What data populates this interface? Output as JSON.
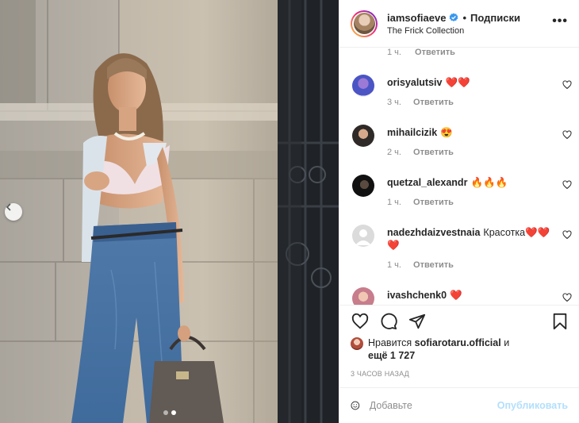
{
  "header": {
    "username": "iamsofiaeve",
    "separator": "•",
    "follow_label": "Подписки",
    "location": "The Frick Collection",
    "more_icon": "more-horizontal-icon"
  },
  "previous_comment_meta": {
    "time": "1 ч.",
    "reply": "Ответить"
  },
  "comments": [
    {
      "user": "orisyalutsiv",
      "text": "❤️❤️",
      "time": "3 ч.",
      "reply": "Ответить"
    },
    {
      "user": "mihailcizik",
      "text": "😍",
      "time": "2 ч.",
      "reply": "Ответить"
    },
    {
      "user": "quetzal_alexandr",
      "text": "🔥🔥🔥",
      "time": "1 ч.",
      "reply": "Ответить"
    },
    {
      "user": "nadezhdaizvestnaia",
      "text": "Красотка❤️❤️❤️",
      "time": "1 ч.",
      "reply": "Ответить"
    },
    {
      "user": "ivashchenk0",
      "text": "❤️",
      "time": "",
      "reply": ""
    }
  ],
  "likes": {
    "prefix": "Нравится",
    "user": "sofiarotaru.official",
    "and": "и",
    "more": "ещё 1 727"
  },
  "timestamp": "3 ЧАСОВ НАЗАД",
  "composer": {
    "placeholder": "Добавьте",
    "publish_label": "Опубликовать"
  },
  "colors": {
    "accent_link": "#b2dffc",
    "verified": "#3897f0",
    "muted": "#8e8e8e"
  }
}
